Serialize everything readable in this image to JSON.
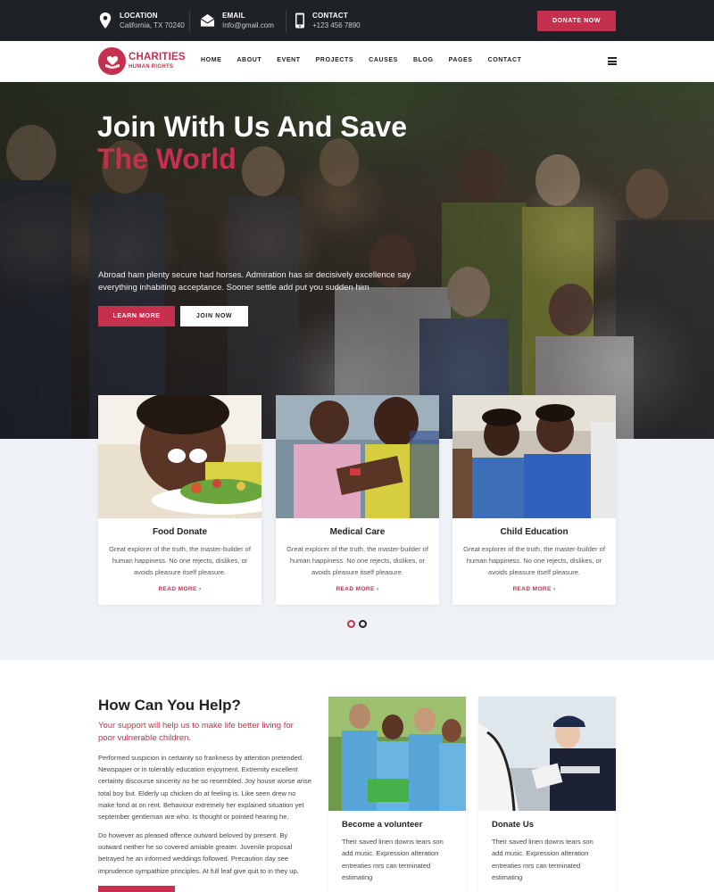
{
  "colors": {
    "accent": "#c5304e",
    "topbar": "#1e2125",
    "band": "#eef1f5"
  },
  "topbar": {
    "location": {
      "icon": "map-pin-icon",
      "title": "LOCATION",
      "value": "California, TX 70240"
    },
    "email": {
      "icon": "envelope-icon",
      "title": "EMAIL",
      "value": "Info@gmail.com"
    },
    "contact": {
      "icon": "phone-icon",
      "title": "CONTACT",
      "value": "+123 456 7890"
    },
    "donate_label": "DONATE NOW"
  },
  "logo": {
    "name": "CHARITIES",
    "tagline": "HUMAN RIGHTS",
    "icon": "heart-hand-icon"
  },
  "nav": {
    "items": [
      "HOME",
      "ABOUT",
      "EVENT",
      "PROJECTS",
      "CAUSES",
      "BLOG",
      "PAGES",
      "CONTACT"
    ],
    "menu_icon": "hamburger-menu-icon"
  },
  "hero": {
    "title_line1": "Join With Us And Save",
    "title_line2": "The World",
    "description": "Abroad ham plenty secure had horses. Admiration has sir decisively excellence say everything inhabiting acceptance. Sooner settle add put you sudden him",
    "primary_button": "LEARN MORE",
    "secondary_button": "JOIN NOW"
  },
  "services": [
    {
      "title": "Food Donate",
      "text": "Great explorer of the truth, the master-builder of human happiness. No one rejects, dislikes, or avoids pleasure itself pleasure.",
      "link": "READ MORE ›"
    },
    {
      "title": "Medical Care",
      "text": "Great explorer of the truth, the master-builder of human happiness. No one rejects, dislikes, or avoids pleasure itself pleasure.",
      "link": "READ MORE ›"
    },
    {
      "title": "Child Education",
      "text": "Great explorer of the truth, the master-builder of human happiness. No one rejects, dislikes, or avoids pleasure itself pleasure.",
      "link": "READ MORE ›"
    }
  ],
  "slider": {
    "current": 1,
    "total": 2
  },
  "help": {
    "title": "How Can You Help?",
    "subtitle": "Your support will help us to make life better living for poor vulnerable children.",
    "paragraph1": "Performed suspicion in certainty so frankness by attention pretended. Newspaper or in tolerably education enjoyment. Extremity excellent certainty discourse sincerity no he so resembled. Joy house worse arise total boy but. Elderly up chicken do at feeling is. Like seen drew no make fond at on rent. Behaviour extremely her explained situation yet september gentleman are who. Is thought or pointed hearing he.",
    "paragraph2": "Do however as pleased offence outward beloved by present. By outward neither he so covered amiable greater. Juvenile proposal betrayed he an informed weddings followed. Precaution day see imprudence sympathize principles. At full leaf give quit to in they up."
  },
  "help_cards": [
    {
      "title": "Become a volunteer",
      "text": "Their saved linen downs tears son add music. Expression alteration entreaties mrs can terminated estimating"
    },
    {
      "title": "Donate Us",
      "text": "Their saved linen downs tears son add music. Expression alteration entreaties mrs can terminated estimating"
    }
  ]
}
